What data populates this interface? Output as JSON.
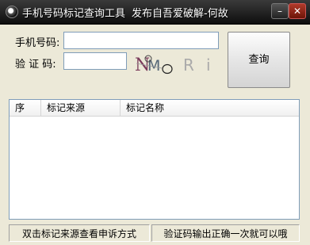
{
  "window": {
    "title": "手机号码标记查询工具",
    "title_suffix": "发布自吾爱破解-何故",
    "minimize_glyph": "–",
    "close_glyph": "✕"
  },
  "form": {
    "phone_label": "手机号码:",
    "phone_value": "",
    "code_label": "验 证 码:",
    "code_value": "",
    "captcha_text": "NMoRi",
    "query_button": "查询"
  },
  "table": {
    "columns": [
      "序",
      "标记来源",
      "标记名称"
    ],
    "rows": []
  },
  "status": {
    "left": "双击标记来源查看申诉方式",
    "right": "验证码输出正确一次就可以哦"
  },
  "colors": {
    "titlebar": "#1a1a1a",
    "window_bg": "#ece9d8",
    "input_border": "#7f9db9"
  }
}
